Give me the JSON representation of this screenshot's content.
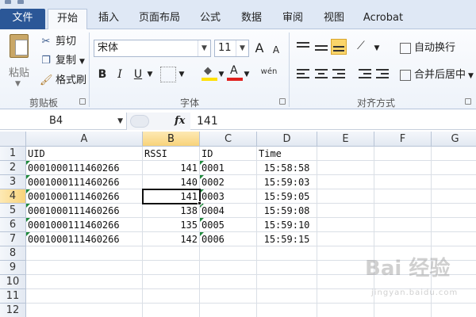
{
  "tabs": [
    "文件",
    "开始",
    "插入",
    "页面布局",
    "公式",
    "数据",
    "审阅",
    "视图",
    "Acrobat"
  ],
  "ribbon": {
    "clipboard": {
      "paste": "粘贴",
      "cut": "剪切",
      "copy": "复制",
      "format_painter": "格式刷",
      "label": "剪贴板"
    },
    "font": {
      "name": "宋体",
      "size": "11",
      "bold": "B",
      "italic": "I",
      "underline": "U",
      "label": "字体",
      "grow": "A",
      "shrink": "A",
      "phonetic": "wén"
    },
    "alignment": {
      "wrap_text": "自动换行",
      "merge_center": "合并后居中",
      "label": "对齐方式"
    }
  },
  "formula_bar": {
    "name_box": "B4",
    "fx": "fx",
    "value": "141"
  },
  "columns": [
    "A",
    "B",
    "C",
    "D",
    "E",
    "F",
    "G"
  ],
  "rows": [
    "1",
    "2",
    "3",
    "4",
    "5",
    "6",
    "7",
    "8",
    "9",
    "10",
    "11",
    "12"
  ],
  "table": {
    "headers": [
      "UID",
      "RSSI",
      "ID",
      "Time"
    ],
    "data": [
      [
        "0001000111460266",
        "141",
        "0001",
        "15:58:58"
      ],
      [
        "0001000111460266",
        "140",
        "0002",
        "15:59:03"
      ],
      [
        "0001000111460266",
        "141",
        "0003",
        "15:59:05"
      ],
      [
        "0001000111460266",
        "138",
        "0004",
        "15:59:08"
      ],
      [
        "0001000111460266",
        "135",
        "0005",
        "15:59:10"
      ],
      [
        "0001000111460266",
        "142",
        "0006",
        "15:59:15"
      ]
    ]
  },
  "active_cell": "B4",
  "watermark": {
    "main": "Bai 经验",
    "sub": "jingyan.baidu.com"
  },
  "colors": {
    "file_tab": "#2b5797",
    "selection_header": "#f8d37a",
    "text_indicator": "#1f8a3c"
  }
}
